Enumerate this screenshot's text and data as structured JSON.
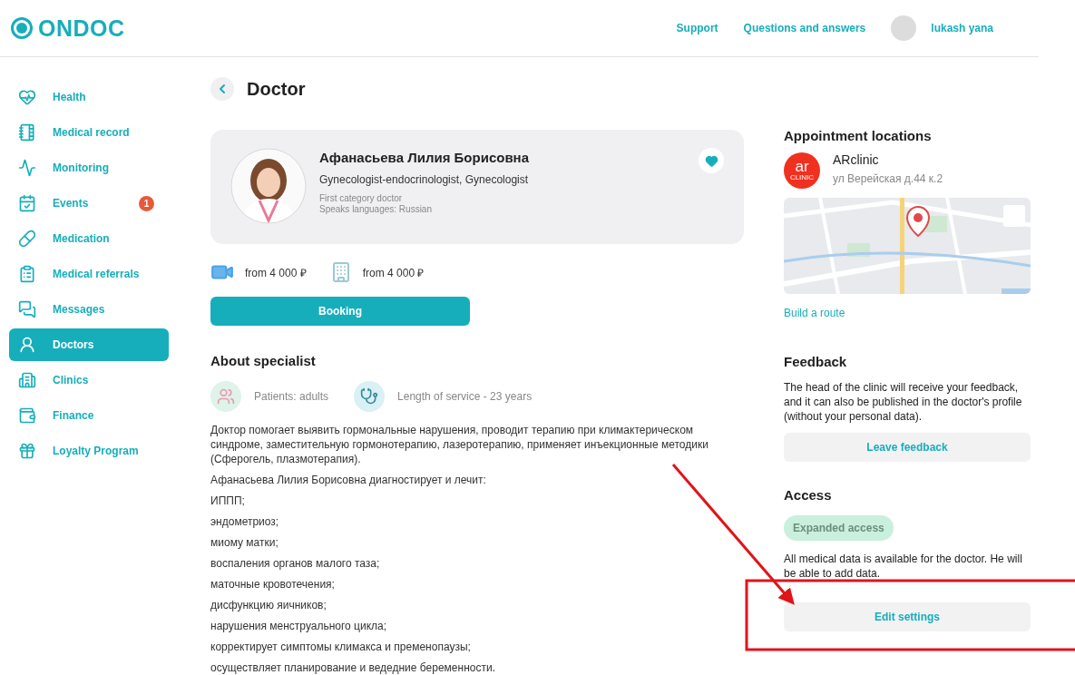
{
  "header": {
    "logo": "ONDOC",
    "links": [
      "Support",
      "Questions and answers"
    ],
    "user": "lukash yana"
  },
  "sidebar": {
    "items": [
      {
        "label": "Health",
        "selected": false
      },
      {
        "label": "Medical record",
        "selected": false
      },
      {
        "label": "Monitoring",
        "selected": false
      },
      {
        "label": "Events",
        "selected": false,
        "badge": "1"
      },
      {
        "label": "Medication",
        "selected": false
      },
      {
        "label": "Medical referrals",
        "selected": false
      },
      {
        "label": "Messages",
        "selected": false
      },
      {
        "label": "Doctors",
        "selected": true
      },
      {
        "label": "Clinics",
        "selected": false
      },
      {
        "label": "Finance",
        "selected": false
      },
      {
        "label": "Loyalty Program",
        "selected": false
      }
    ]
  },
  "page_title": "Doctor",
  "doctor": {
    "name": "Афанасьева Лилия Борисовна",
    "specialty": "Gynecologist-endocrinologist, Gynecologist",
    "category": "First category doctor",
    "languages": "Speaks languages: Russian",
    "favorite": true
  },
  "prices": [
    {
      "kind": "video",
      "text": "from 4 000 ₽"
    },
    {
      "kind": "clinic",
      "text": "from 4 000 ₽"
    }
  ],
  "booking_button": "Booking",
  "about": {
    "title": "About specialist",
    "facts": [
      {
        "kind": "patients",
        "text": "Patients: adults"
      },
      {
        "kind": "experience",
        "text": "Length of service - 23 years"
      }
    ],
    "paragraphs": [
      "Доктор помогает выявить гормональные нарушения, проводит терапию при климактерическом синдроме, заместительную гормонотерапию, лазеротерапию, применяет инъекционные методики (Сферогель, плазмотерапия).",
      "Афанасьева Лилия Борисовна диагностирует и лечит:",
      "ИППП;",
      "эндометриоз;",
      "миому матки;",
      "воспаления органов малого таза;",
      "маточные кровотечения;",
      "дисфункцию яичников;",
      "нарушения менструального цикла;",
      "корректирует симптомы климакса и пременопаузы;",
      "осуществляет планирование и ведедние беременности."
    ]
  },
  "locations": {
    "title": "Appointment locations",
    "clinic": {
      "logo": "ar",
      "logo_sub": "CLINIC",
      "name": "ARclinic",
      "address": "ул Верейская д.44 к.2"
    },
    "route_link": "Build a route"
  },
  "feedback": {
    "title": "Feedback",
    "text": "The head of the clinic will receive your feedback, and it can also be published in the doctor's profile (without your personal data).",
    "button": "Leave feedback"
  },
  "access": {
    "title": "Access",
    "badge": "Expanded access",
    "text": "All medical data is available for the doctor. He will be able to add data.",
    "button": "Edit settings"
  }
}
